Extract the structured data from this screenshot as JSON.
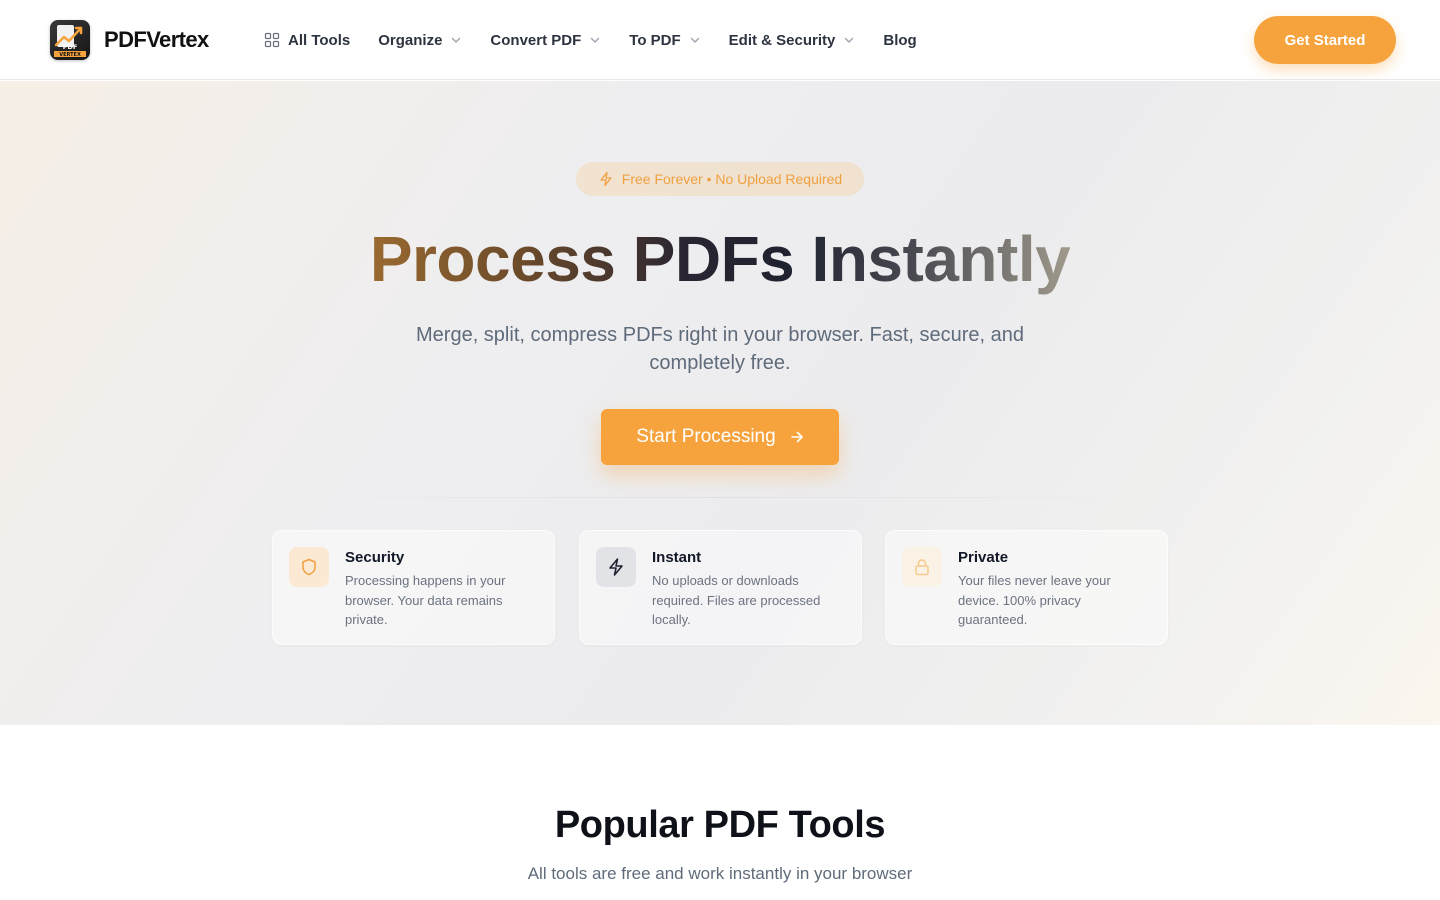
{
  "header": {
    "logo_text": "PDFVertex",
    "logo_mark_line1": "PDF",
    "logo_mark_line2": "VERTEX",
    "nav": [
      {
        "label": "All Tools",
        "has_dropdown": false,
        "icon": "grid-icon"
      },
      {
        "label": "Organize",
        "has_dropdown": true
      },
      {
        "label": "Convert PDF",
        "has_dropdown": true
      },
      {
        "label": "To PDF",
        "has_dropdown": true
      },
      {
        "label": "Edit & Security",
        "has_dropdown": true
      },
      {
        "label": "Blog",
        "has_dropdown": false
      }
    ],
    "cta_label": "Get Started"
  },
  "hero": {
    "badge": "Free Forever • No Upload Required",
    "title": "Process PDFs Instantly",
    "subtitle": "Merge, split, compress PDFs right in your browser. Fast, secure, and completely free.",
    "start_label": "Start Processing",
    "features": [
      {
        "title": "Security",
        "description": "Processing happens in your browser. Your data remains private.",
        "icon": "shield-icon"
      },
      {
        "title": "Instant",
        "description": "No uploads or downloads required. Files are processed locally.",
        "icon": "lightning-icon"
      },
      {
        "title": "Private",
        "description": "Your files never leave your device. 100% privacy guaranteed.",
        "icon": "lock-icon"
      }
    ]
  },
  "popular": {
    "title": "Popular PDF Tools",
    "subtitle": "All tools are free and work instantly in your browser"
  },
  "colors": {
    "accent": "#f6a33e",
    "text_muted": "#5f6b7a",
    "nav_text": "#2d3440"
  }
}
